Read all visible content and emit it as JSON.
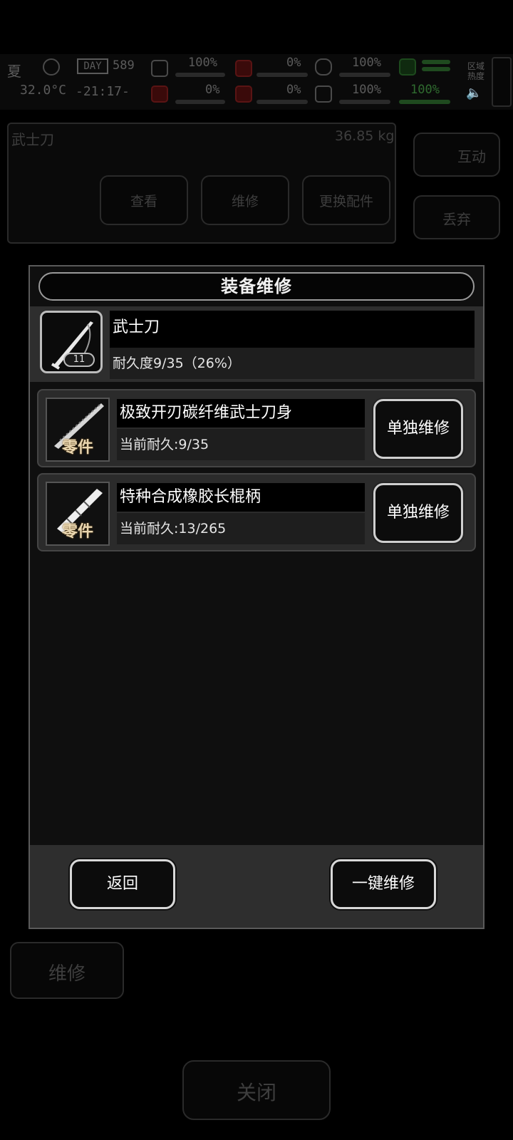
{
  "hud": {
    "season": "夏",
    "temperature": "32.0°C",
    "day_label": "DAY",
    "day_number": "589",
    "clock": "-21:17-",
    "stats": [
      "100%",
      "0%",
      "100%",
      "0%",
      "0%",
      "100%",
      "100%"
    ],
    "region_label": "区域热度"
  },
  "background": {
    "item_title": "武士刀",
    "item_weight": "36.85 kg",
    "btn_view": "查看",
    "btn_repair": "维修",
    "btn_swap_parts": "更换配件",
    "btn_interact": "互动",
    "btn_discard": "丢弃",
    "btn_repair_side": "维修",
    "btn_close": "关闭"
  },
  "modal": {
    "title": "装备维修",
    "item": {
      "name": "武士刀",
      "level": "11",
      "durability": "耐久度9/35（26%）"
    },
    "parts": [
      {
        "name": "极致开刃碳纤维武士刀身",
        "current": "当前耐久:9/35",
        "tag": "零件",
        "button": "单独维修"
      },
      {
        "name": "特种合成橡胶长棍柄",
        "current": "当前耐久:13/265",
        "tag": "零件",
        "button": "单独维修"
      }
    ],
    "back_label": "返回",
    "repair_all_label": "一键维修"
  }
}
